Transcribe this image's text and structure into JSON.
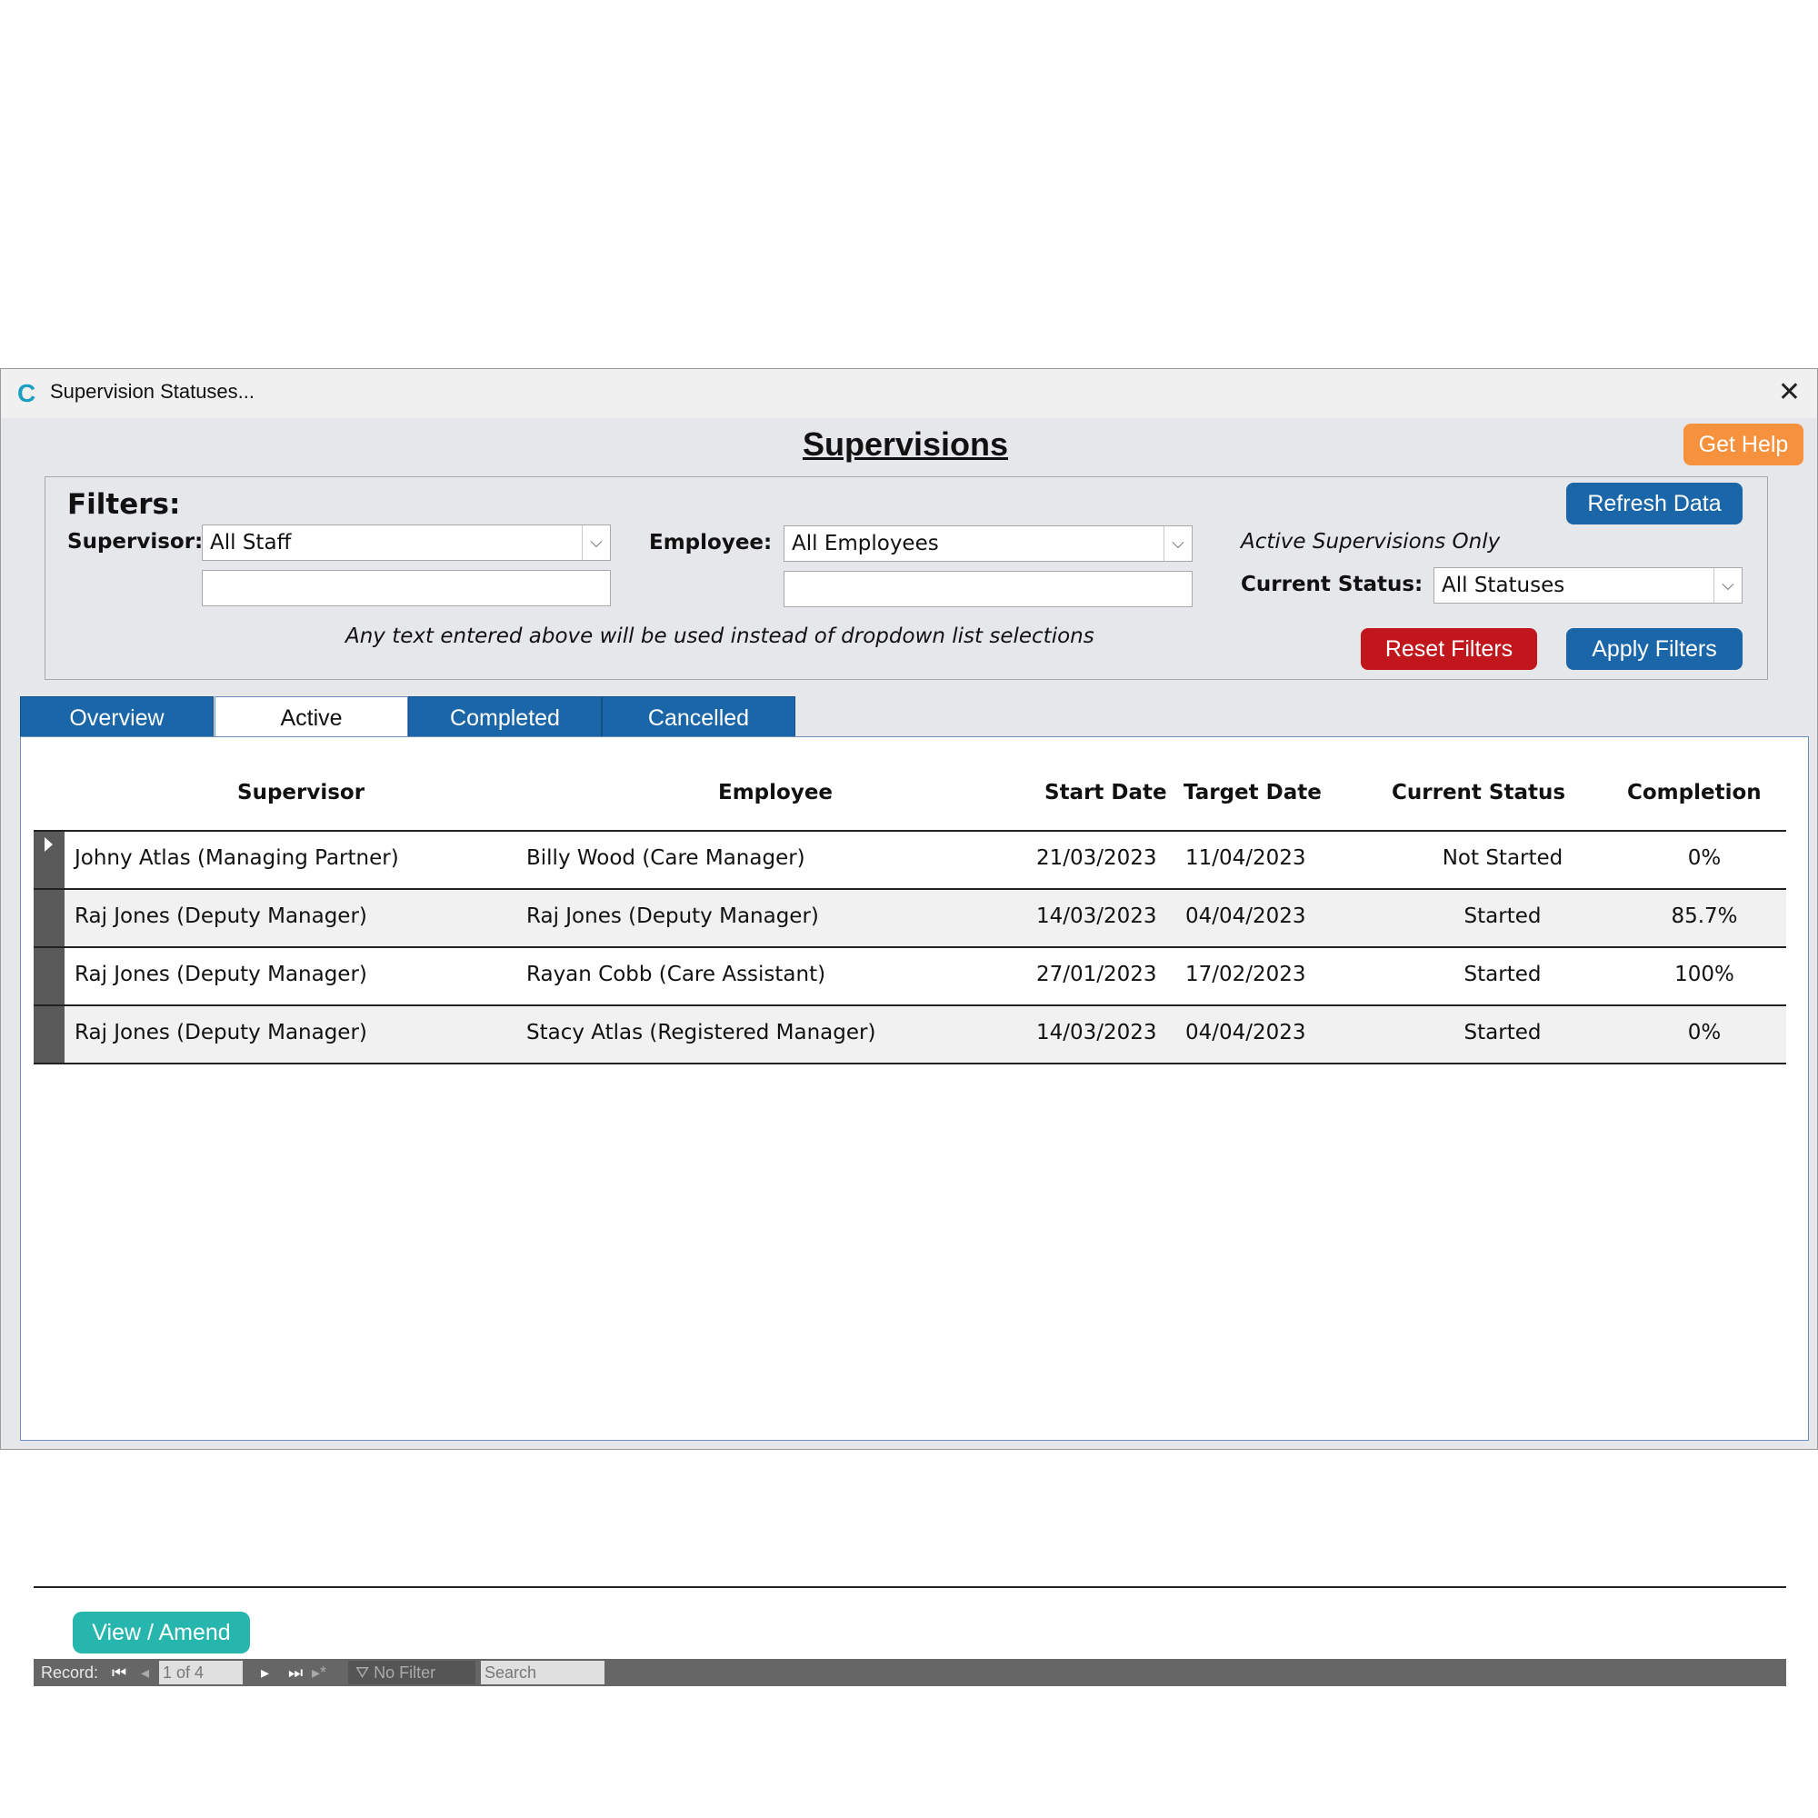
{
  "window": {
    "title": "Supervision Statuses...",
    "icon": "app-logo-icon"
  },
  "header": {
    "title": "Supervisions",
    "help_label": "Get Help"
  },
  "filters": {
    "label": "Filters:",
    "supervisor_label": "Supervisor:",
    "supervisor_value": "All Staff",
    "supervisor_text": "",
    "employee_label": "Employee:",
    "employee_value": "All Employees",
    "employee_text": "",
    "hint": "Any text entered above will be used instead of dropdown list selections",
    "active_only": "Active Supervisions Only",
    "status_label": "Current Status:",
    "status_value": "All Statuses",
    "refresh_label": "Refresh Data",
    "reset_label": "Reset Filters",
    "apply_label": "Apply Filters"
  },
  "tabs": [
    {
      "label": "Overview",
      "active": false
    },
    {
      "label": "Active",
      "active": true
    },
    {
      "label": "Completed",
      "active": false
    },
    {
      "label": "Cancelled",
      "active": false
    }
  ],
  "grid": {
    "columns": [
      "Supervisor",
      "Employee",
      "Start Date",
      "Target Date",
      "Current Status",
      "Completion"
    ],
    "rows": [
      [
        "Johny Atlas (Managing Partner)",
        "Billy Wood (Care Manager)",
        "21/03/2023",
        "11/04/2023",
        "Not Started",
        "0%"
      ],
      [
        "Raj Jones (Deputy Manager)",
        "Raj Jones (Deputy Manager)",
        "14/03/2023",
        "04/04/2023",
        "Started",
        "85.7%"
      ],
      [
        "Raj Jones (Deputy Manager)",
        "Rayan Cobb (Care Assistant)",
        "27/01/2023",
        "17/02/2023",
        "Started",
        "100%"
      ],
      [
        "Raj Jones (Deputy Manager)",
        "Stacy Atlas (Registered Manager)",
        "14/03/2023",
        "04/04/2023",
        "Started",
        "0%"
      ]
    ]
  },
  "actions": {
    "view_amend_label": "View / Amend"
  },
  "navigation": {
    "record_label": "Record:",
    "position": "1 of 4",
    "filter_label": "No Filter",
    "search_placeholder": "Search"
  },
  "colors": {
    "primary": "#1a66a8",
    "danger": "#c0161c",
    "help": "#f6923e",
    "accent": "#27b6ad"
  }
}
